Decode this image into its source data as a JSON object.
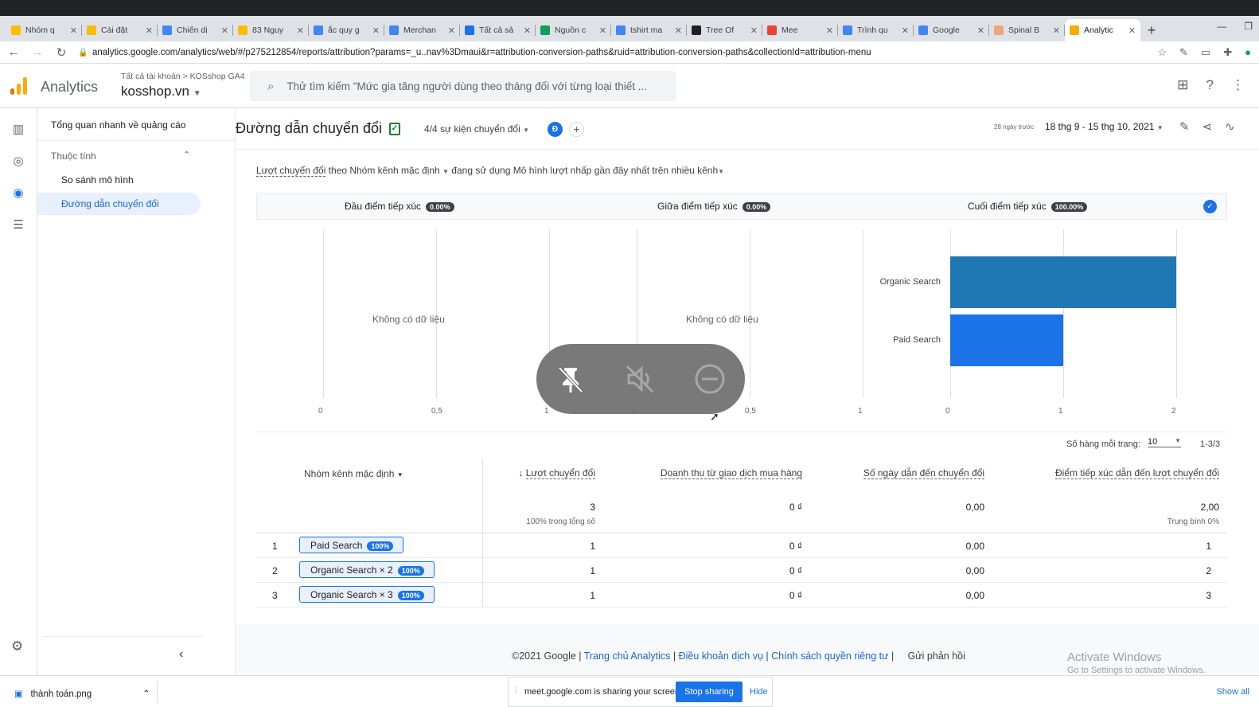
{
  "browser": {
    "tabs": [
      {
        "label": "Nhóm q",
        "color": "#fbbc04"
      },
      {
        "label": "Cài đặt",
        "color": "#fbbc04"
      },
      {
        "label": "Chiến dị",
        "color": "#4285f4"
      },
      {
        "label": "83 Nguy",
        "color": "#fbbc04"
      },
      {
        "label": "ắc quy g",
        "color": "#4285f4"
      },
      {
        "label": "Merchan",
        "color": "#4285f4"
      },
      {
        "label": "Tất cả sả",
        "color": "#1a73e8"
      },
      {
        "label": "Nguồn c",
        "color": "#0f9d58"
      },
      {
        "label": "tshirt ma",
        "color": "#4285f4"
      },
      {
        "label": "Tree Of",
        "color": "#202124"
      },
      {
        "label": "Mee",
        "color": "#ea4335"
      },
      {
        "label": "Trình qu",
        "color": "#4285f4"
      },
      {
        "label": "Google",
        "color": "#4285f4"
      },
      {
        "label": "Spinal B",
        "color": "#e8a87c"
      },
      {
        "label": "Analytic",
        "color": "#f9ab00"
      }
    ],
    "url": "analytics.google.com/analytics/web/#/p275212854/reports/attribution?params=_u..nav%3Dmaui&r=attribution-conversion-paths&ruid=attribution-conversion-paths&collectionId=attribution-menu"
  },
  "header": {
    "app_name": "Analytics",
    "breadcrumb": "Tất cả tài khoản > KOSshop GA4",
    "property": "kosshop.vn",
    "search_placeholder": "Thử tìm kiếm \"Mức gia tăng người dùng theo tháng đối với từng loại thiết ..."
  },
  "sidenav": {
    "overview": "Tổng quan nhanh về quảng cáo",
    "group": "Thuộc tính",
    "item_compare": "So sánh mô hình",
    "item_paths": "Đường dẫn chuyển đổi"
  },
  "report": {
    "title": "Đường dẫn chuyển đổi",
    "events": "4/4 sự kiện chuyển đổi",
    "compare_avatar": "Đ",
    "date_prefix": "28 ngày trước",
    "date_range": "18 thg 9 - 15 thg 10, 2021",
    "subtitle_a": "Lượt chuyển đổi",
    "subtitle_b": " theo Nhóm kênh mặc định ",
    "subtitle_c": " đang sử dụng Mô hình lượt nhấp gần đây nhất trên nhiều kênh",
    "touchpoints": [
      {
        "label": "Đầu điểm tiếp xúc",
        "pct": "0.00%"
      },
      {
        "label": "Giữa điểm tiếp xúc",
        "pct": "0.00%"
      },
      {
        "label": "Cuối điểm tiếp xúc",
        "pct": "100.00%"
      }
    ],
    "no_data": "Không có dữ liệu"
  },
  "chart_data": [
    {
      "type": "bar",
      "title": "Đầu điểm tiếp xúc",
      "categories": [],
      "values": [],
      "xlim": [
        0,
        1
      ],
      "xticks": [
        "0",
        "0,5",
        "1"
      ]
    },
    {
      "type": "bar",
      "title": "Giữa điểm tiếp xúc",
      "categories": [],
      "values": [],
      "xlim": [
        0,
        1
      ],
      "xticks": [
        "0",
        "0,5",
        "1"
      ]
    },
    {
      "type": "bar",
      "title": "Cuối điểm tiếp xúc",
      "orientation": "horizontal",
      "categories": [
        "Organic Search",
        "Paid Search"
      ],
      "values": [
        2,
        1
      ],
      "colors": [
        "#1f78b4",
        "#1a73e8"
      ],
      "xlim": [
        0,
        2
      ],
      "xticks": [
        "0",
        "1",
        "2"
      ]
    }
  ],
  "pagination": {
    "label": "Số hàng mỗi trang:",
    "value": "10",
    "range": "1-3/3"
  },
  "table": {
    "dim_header": "Nhóm kênh mặc định",
    "headers": [
      "Lượt chuyển đổi",
      "Doanh thu từ giao dịch mua hàng",
      "Số ngày dẫn đến chuyển đổi",
      "Điểm tiếp xúc dẫn đến lượt chuyển đổi"
    ],
    "totals": [
      "3",
      "0 ₫",
      "0,00",
      "2,00"
    ],
    "total_sub_conv": "100% trong tổng số",
    "total_sub_touch": "Trung bình 0%",
    "rows": [
      {
        "num": "1",
        "path": "Paid Search",
        "pct": "100%",
        "conv": "1",
        "rev": "0 ₫",
        "days": "0,00",
        "touch": "1"
      },
      {
        "num": "2",
        "path": "Organic Search × 2",
        "pct": "100%",
        "conv": "1",
        "rev": "0 ₫",
        "days": "0,00",
        "touch": "2"
      },
      {
        "num": "3",
        "path": "Organic Search × 3",
        "pct": "100%",
        "conv": "1",
        "rev": "0 ₫",
        "days": "0,00",
        "touch": "3"
      }
    ]
  },
  "footer": {
    "copyright": "©2021 Google | ",
    "link_home": "Trang chủ Analytics",
    "link_terms": "Điều khoản dịch vụ",
    "link_privacy": "Chính sách quyền riêng tư",
    "feedback": "Gửi phản hồi"
  },
  "watermark": {
    "line1": "Activate Windows",
    "line2": "Go to Settings to activate Windows."
  },
  "downloads": {
    "file": "thành toán.png",
    "show_all": "Show all"
  },
  "sharing": {
    "text": "meet.google.com is sharing your screen.",
    "stop": "Stop sharing",
    "hide": "Hide"
  }
}
